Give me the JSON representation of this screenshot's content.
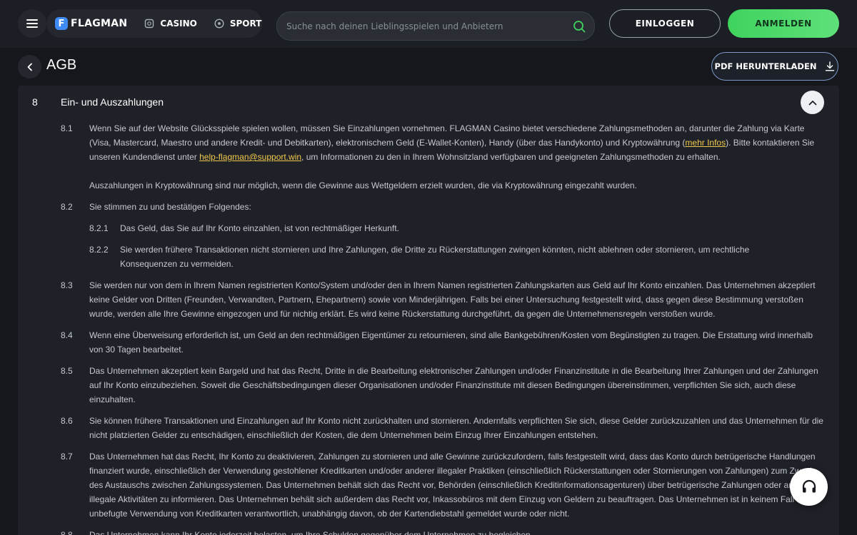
{
  "header": {
    "logo_letter": "F",
    "logo_text": "FLAGMAN",
    "nav": [
      {
        "label": "CASINO",
        "icon": "casino-chip-icon"
      },
      {
        "label": "SPORT",
        "icon": "football-icon"
      }
    ],
    "search_placeholder": "Suche nach deinen Lieblingsspielen und Anbietern",
    "login_label": "EINLOGGEN",
    "register_label": "ANMELDEN"
  },
  "page": {
    "title": "AGB",
    "pdf_label": "PDF HERUNTERLADEN"
  },
  "section": {
    "number": "8",
    "title": "Ein- und Auszahlungen",
    "items": [
      {
        "num": "8.1",
        "text_a": "Wenn Sie auf der Website Glücksspiele spielen wollen, müssen Sie Einzahlungen vornehmen. FLAGMAN Casino bietet verschiedene Zahlungsmethoden an, darunter die Zahlung via Karte (Visa, Mastercard, Maestro und andere Kredit- und Debitkarten), elektronischem Geld (E-Wallet-Konten), Handy (über das Handykonto) und Kryptowährung (",
        "link1": "mehr Infos",
        "text_b": "). Bitte kontaktieren Sie unseren Kundendienst unter ",
        "link2": "help-flagman@support.win",
        "text_c": ", um Informationen zu den in Ihrem Wohnsitzland verfügbaren und geeigneten Zahlungsmethoden zu erhalten.",
        "text_d": "Auszahlungen in Kryptowährung sind nur möglich, wenn die Gewinne aus Wettgeldern erzielt wurden, die via Kryptowährung eingezahlt wurden."
      },
      {
        "num": "8.2",
        "text": "Sie stimmen zu und bestätigen Folgendes:"
      },
      {
        "num": "8.2.1",
        "text": "Das Geld, das Sie auf Ihr Konto einzahlen, ist von rechtmäßiger Herkunft."
      },
      {
        "num": "8.2.2",
        "text": "Sie werden frühere Transaktionen nicht stornieren und Ihre Zahlungen, die Dritte zu Rückerstattungen zwingen könnten, nicht ablehnen oder stornieren, um rechtliche Konsequenzen zu vermeiden."
      },
      {
        "num": "8.3",
        "text": "Sie werden nur von dem in Ihrem Namen registrierten Konto/System und/oder den in Ihrem Namen registrierten Zahlungskarten aus Geld auf Ihr Konto einzahlen. Das Unternehmen akzeptiert keine Gelder von Dritten (Freunden, Verwandten, Partnern, Ehepartnern) sowie von Minderjährigen. Falls bei einer Untersuchung festgestellt wird, dass gegen diese Bestimmung verstoßen wurde, werden alle Ihre Gewinne eingezogen und für nichtig erklärt. Es wird keine Rückerstattung durchgeführt, da gegen die Unternehmensregeln verstoßen wurde."
      },
      {
        "num": "8.4",
        "text": "Wenn eine Überweisung erforderlich ist, um Geld an den rechtmäßigen Eigentümer zu retournieren, sind alle Bankgebühren/Kosten vom Begünstigten zu tragen. Die Erstattung wird innerhalb von 30 Tagen bearbeitet."
      },
      {
        "num": "8.5",
        "text": "Das Unternehmen akzeptiert kein Bargeld und hat das Recht, Dritte in die Bearbeitung elektronischer Zahlungen und/oder Finanzinstitute in die Bearbeitung Ihrer Zahlungen und der Zahlungen auf Ihr Konto einzubeziehen. Soweit die Geschäftsbedingungen dieser Organisationen und/oder Finanzinstitute mit diesen Bedingungen übereinstimmen, verpflichten Sie sich, auch diese einzuhalten."
      },
      {
        "num": "8.6",
        "text": "Sie können frühere Transaktionen und Einzahlungen auf Ihr Konto nicht zurückhalten und stornieren. Andernfalls verpflichten Sie sich, diese Gelder zurückzuzahlen und das Unternehmen für die nicht platzierten Gelder zu entschädigen, einschließlich der Kosten, die dem Unternehmen beim Einzug Ihrer Einzahlungen entstehen."
      },
      {
        "num": "8.7",
        "text": "Das Unternehmen hat das Recht, Ihr Konto zu deaktivieren, Zahlungen zu stornieren und alle Gewinne zurückzufordern, falls festgestellt wird, dass das Konto durch betrügerische Handlungen finanziert wurde, einschließlich der Verwendung gestohlener Kreditkarten und/oder anderer illegaler Praktiken (einschließlich Rückerstattungen oder Stornierungen von Zahlungen) zum Zweck des Austauschs zwischen Zahlungssystemen. Das Unternehmen behält sich das Recht vor, Behörden (einschließlich Kreditinformationsagenturen) über betrügerische Zahlungen oder andere illegale Aktivitäten zu informieren. Das Unternehmen behält sich außerdem das Recht vor, Inkassobüros mit dem Einzug von Geldern zu beauftragen. Das Unternehmen ist in keinem Fall für die unbefugte Verwendung von Kreditkarten verantwortlich, unabhängig davon, ob der Kartendiebstahl gemeldet wurde oder nicht."
      },
      {
        "num": "8.8",
        "text": "Das Unternehmen kann Ihr Konto jederzeit belasten, um Ihre Schulden gegenüber dem Unternehmen zu begleichen."
      }
    ]
  }
}
